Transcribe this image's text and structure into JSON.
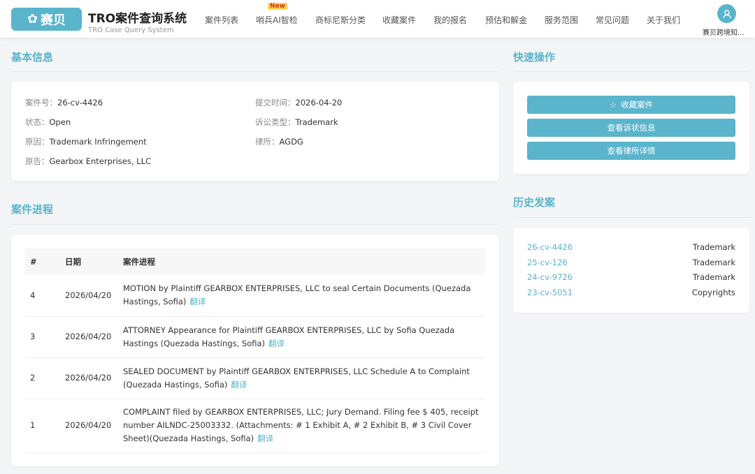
{
  "header": {
    "logo_text": "赛贝",
    "title": "TRO案件查询系统",
    "subtitle": "TRO Case Query System",
    "nav": [
      "案件列表",
      "哨兵AI智检",
      "商标尼斯分类",
      "收藏案件",
      "我的报名",
      "预估和解金",
      "服务范围",
      "常见问题",
      "关于我们"
    ],
    "new_badge": "New",
    "user_name": "赛贝跨境知..."
  },
  "basic": {
    "title": "基本信息",
    "fields": [
      {
        "k": "案件号：",
        "v": "26-cv-4426"
      },
      {
        "k": "提交时间：",
        "v": "2026-04-20"
      },
      {
        "k": "状态：",
        "v": "Open"
      },
      {
        "k": "诉讼类型：",
        "v": "Trademark"
      },
      {
        "k": "原因：",
        "v": "Trademark Infringement"
      },
      {
        "k": "律所：",
        "v": "AGDG"
      },
      {
        "k": "原告：",
        "v": "Gearbox Enterprises, LLC"
      }
    ]
  },
  "progress": {
    "title": "案件进程",
    "headers": [
      "#",
      "日期",
      "案件进程"
    ],
    "translate": "翻译",
    "rows": [
      {
        "n": "4",
        "date": "2026/04/20",
        "text": "MOTION by Plaintiff GEARBOX ENTERPRISES, LLC to seal Certain Documents (Quezada Hastings, Sofia)"
      },
      {
        "n": "3",
        "date": "2026/04/20",
        "text": "ATTORNEY Appearance for Plaintiff GEARBOX ENTERPRISES, LLC by Sofia Quezada Hastings (Quezada Hastings, Sofia)"
      },
      {
        "n": "2",
        "date": "2026/04/20",
        "text": "SEALED DOCUMENT by Plaintiff GEARBOX ENTERPRISES, LLC Schedule A to Complaint (Quezada Hastings, Sofia)"
      },
      {
        "n": "1",
        "date": "2026/04/20",
        "text": "COMPLAINT filed by GEARBOX ENTERPRISES, LLC; Jury Demand. Filing fee $ 405, receipt number AILNDC-25003332. (Attachments: # 1 Exhibit A, # 2 Exhibit B, # 3 Civil Cover Sheet)(Quezada Hastings, Sofia)"
      }
    ]
  },
  "quick": {
    "title": "快速操作",
    "buttons": [
      "收藏案件",
      "查看诉状信息",
      "查看律所详情"
    ]
  },
  "history": {
    "title": "历史发案",
    "items": [
      {
        "case": "26-cv-4426",
        "type": "Trademark"
      },
      {
        "case": "25-cv-126",
        "type": "Trademark"
      },
      {
        "case": "24-cv-9726",
        "type": "Trademark"
      },
      {
        "case": "23-cv-5051",
        "type": "Copyrights"
      }
    ]
  }
}
